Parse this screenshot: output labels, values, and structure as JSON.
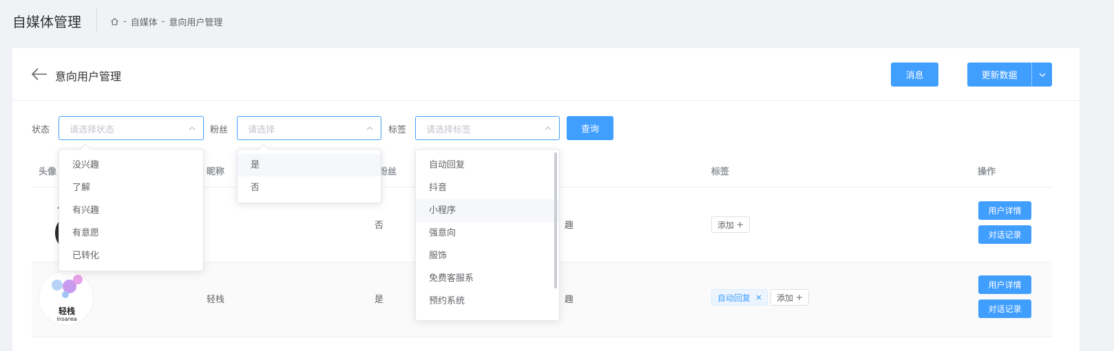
{
  "header": {
    "app_title": "自媒体管理",
    "breadcrumb": [
      "自媒体",
      "意向用户管理"
    ],
    "breadcrumb_sep": "-"
  },
  "page": {
    "title": "意向用户管理",
    "message_button": "消息",
    "update_button": "更新数据"
  },
  "filters": {
    "status_label": "状态",
    "status_placeholder": "请选择状态",
    "fans_label": "粉丝",
    "fans_placeholder": "请选择",
    "tag_label": "标签",
    "tag_placeholder": "请选择标签",
    "query_button": "查询"
  },
  "dropdowns": {
    "status_options": [
      "没兴趣",
      "了解",
      "有兴趣",
      "有意愿",
      "已转化"
    ],
    "fans_options": [
      "是",
      "否"
    ],
    "tag_options": [
      "自动回复",
      "抖音",
      "小程序",
      "强意向",
      "服饰",
      "免费客服系",
      "预约系统"
    ]
  },
  "table": {
    "columns": {
      "avatar": "头像",
      "nickname": "昵称",
      "fans": "粉丝",
      "tags": "标签",
      "actions": "操作"
    },
    "rows": [
      {
        "nickname": "",
        "fans": "否",
        "status_partial": "趣",
        "tags": [],
        "add_tag": "添加"
      },
      {
        "nickname": "轻栈",
        "fans": "是",
        "status_partial": "趣",
        "tags": [
          "自动回复"
        ],
        "add_tag": "添加"
      }
    ],
    "detail_button": "用户详情",
    "chat_button": "对话记录",
    "logo_text_cn": "轻栈",
    "logo_text_en": "insarea"
  },
  "colors": {
    "primary": "#409eff",
    "page_bg": "#f0f2f5"
  }
}
